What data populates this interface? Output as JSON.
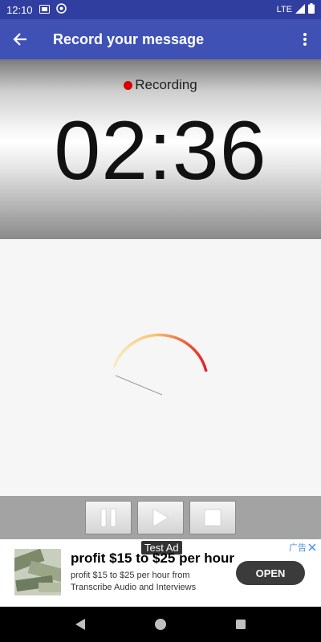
{
  "status_bar": {
    "time": "12:10",
    "network": "LTE",
    "icons": [
      "sim-card-icon",
      "at-sign-icon",
      "signal-icon",
      "battery-icon"
    ]
  },
  "app_bar": {
    "title": "Record your message",
    "back_icon": "back-arrow-icon",
    "menu_icon": "overflow-menu-icon"
  },
  "recorder": {
    "status": "Recording",
    "status_color": "#d50000",
    "elapsed": "02:36"
  },
  "controls": {
    "buttons": [
      "pause-icon",
      "play-icon",
      "stop-icon"
    ]
  },
  "ad": {
    "tag": "Test Ad",
    "choices_label": "广告",
    "headline": "profit $15 to $25 per hour",
    "body": "profit $15 to $25 per hour from Transcribe Audio and Interviews",
    "cta": "OPEN"
  },
  "colors": {
    "status_bar": "#303f9f",
    "app_bar": "#3f51b5",
    "recording_dot": "#d50000"
  }
}
